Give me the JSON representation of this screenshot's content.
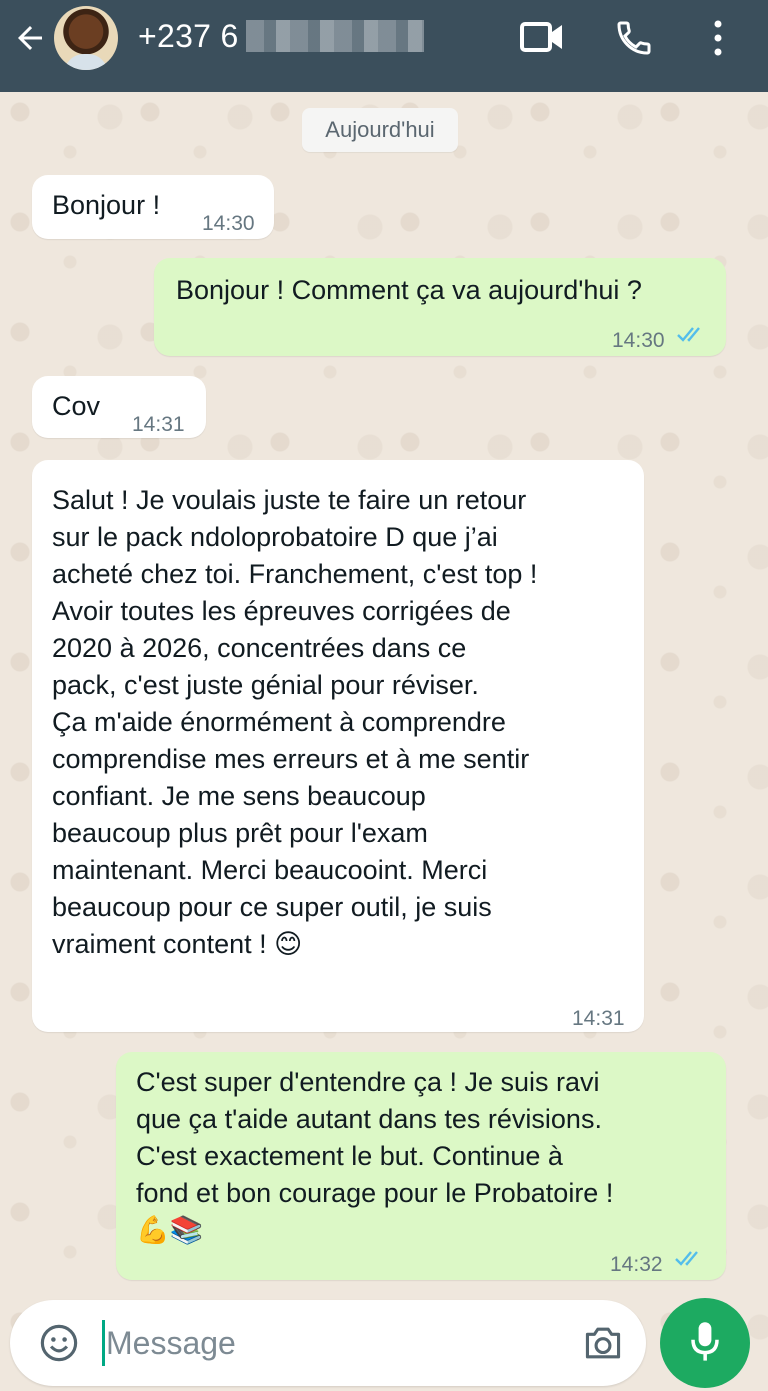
{
  "header": {
    "contact_name": "+237 6",
    "icons": [
      "back-arrow-icon",
      "avatar",
      "video-call-icon",
      "phone-icon",
      "more-vertical-icon"
    ]
  },
  "date_chip": "Aujourd'hui",
  "messages": [
    {
      "direction": "in",
      "text": "Bonjour !",
      "time": "14:30"
    },
    {
      "direction": "out",
      "text": "Bonjour ! Comment ça va aujourd'hui ?",
      "time": "14:30",
      "read": true
    },
    {
      "direction": "in",
      "text": "Cov",
      "time": "14:31"
    },
    {
      "direction": "in",
      "text": "Salut ! Je voulais juste te faire un retour\nsur le pack ndoloprobatoire D que j’ai\nacheté chez toi. Franchement, c'est top !\nAvoir toutes les épreuves corrigées de\n2020 à 2026, concentrées dans ce\npack, c'est juste génial pour réviser.\nÇa m'aide énormément à comprendre\ncomprendise mes erreurs et à me sentir\nconfiant. Je me sens beaucoup\nbeaucoup plus prêt pour l'exam\nmaintenant. Merci beaucooint. Merci\nbeaucoup pour ce super outil, je suis\nvraiment content ! 😊",
      "time": "14:31"
    },
    {
      "direction": "out",
      "text": "C'est super d'entendre ça ! Je suis ravi\nque ça t'aide autant dans tes révisions.\nC'est exactement le but. Continue à\nfond et bon courage pour le Probatoire !\n💪📚",
      "time": "14:32",
      "read": true
    }
  ],
  "composer": {
    "placeholder": "Message"
  },
  "colors": {
    "header_bg": "#3b4f5c",
    "outgoing_bubble": "#dcf8c6",
    "incoming_bubble": "#ffffff",
    "read_ticks": "#53bdeb",
    "mic_button": "#1daa61"
  }
}
